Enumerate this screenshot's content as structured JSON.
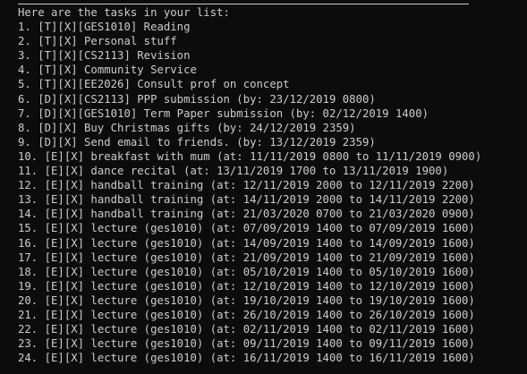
{
  "terminal": {
    "header": "Here are the tasks in your list:",
    "tasks": [
      "1. [T][X][GES1010] Reading",
      "2. [T][X] Personal stuff",
      "3. [T][X][CS2113] Revision",
      "4. [T][X] Community Service",
      "5. [T][X][EE2026] Consult prof on concept",
      "6. [D][X][CS2113] PPP submission (by: 23/12/2019 0800)",
      "7. [D][X][GES1010] Term Paper submission (by: 02/12/2019 1400)",
      "8. [D][X] Buy Christmas gifts (by: 24/12/2019 2359)",
      "9. [D][X] Send email to friends. (by: 13/12/2019 2359)",
      "10. [E][X] breakfast with mum (at: 11/11/2019 0800 to 11/11/2019 0900)",
      "11. [E][X] dance recital (at: 13/11/2019 1700 to 13/11/2019 1900)",
      "12. [E][X] handball training (at: 12/11/2019 2000 to 12/11/2019 2200)",
      "13. [E][X] handball training (at: 14/11/2019 2000 to 14/11/2019 2200)",
      "14. [E][X] handball training (at: 21/03/2020 0700 to 21/03/2020 0900)",
      "15. [E][X] lecture (ges1010) (at: 07/09/2019 1400 to 07/09/2019 1600)",
      "16. [E][X] lecture (ges1010) (at: 14/09/2019 1400 to 14/09/2019 1600)",
      "17. [E][X] lecture (ges1010) (at: 21/09/2019 1400 to 21/09/2019 1600)",
      "18. [E][X] lecture (ges1010) (at: 05/10/2019 1400 to 05/10/2019 1600)",
      "19. [E][X] lecture (ges1010) (at: 12/10/2019 1400 to 12/10/2019 1600)",
      "20. [E][X] lecture (ges1010) (at: 19/10/2019 1400 to 19/10/2019 1600)",
      "21. [E][X] lecture (ges1010) (at: 26/10/2019 1400 to 26/10/2019 1600)",
      "22. [E][X] lecture (ges1010) (at: 02/11/2019 1400 to 02/11/2019 1600)",
      "23. [E][X] lecture (ges1010) (at: 09/11/2019 1400 to 09/11/2019 1600)",
      "24. [E][X] lecture (ges1010) (at: 16/11/2019 1400 to 16/11/2019 1600)"
    ]
  }
}
